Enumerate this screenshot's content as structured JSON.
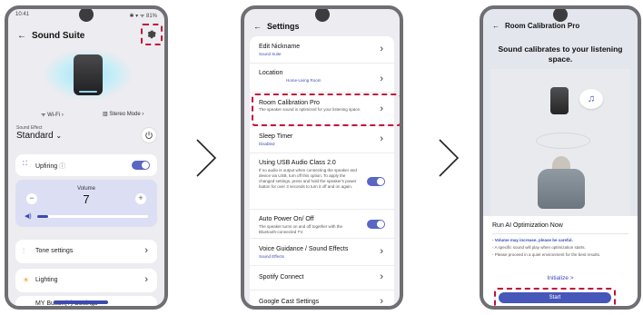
{
  "screen1": {
    "status_time": "10:41",
    "status_right": "✱ ▾ ᯤ 81%",
    "back_arrow": "←",
    "title": "Sound Suite",
    "wifi_label": "Wi-Fi",
    "stereo_label": "Stereo Mode",
    "sound_effect_label": "Sound Effect",
    "sound_effect_value": "Standard",
    "upfiring_label": "Upfiring",
    "volume_label": "Volume",
    "volume_value": "7",
    "volume_level": 0.1,
    "volume_minus": "−",
    "volume_plus": "+",
    "tone_label": "Tone settings",
    "lighting_label": "Lighting",
    "mybutton_label": "MY Button(?) Settings",
    "chevron": "›"
  },
  "screen2": {
    "back_arrow": "←",
    "title": "Settings",
    "items": [
      {
        "title": "Edit Nickname",
        "sub": "Sound Suite"
      },
      {
        "title": "Location",
        "sub": "Home-Living Room"
      },
      {
        "title": "Room Calibration Pro",
        "desc": "The speaker sound is optimized for your listening space."
      },
      {
        "title": "Sleep Timer",
        "sub": "Disabled"
      },
      {
        "title": "Using USB Audio Class 2.0",
        "desc": "If no audio is output when connecting the speaker and device via USB, turn off this option. To apply the changed settings, press and hold the speaker's power button for over 3 seconds to turn it off and on again."
      },
      {
        "title": "Auto Power On/ Off",
        "desc": "The speaker turns on and off together with the Bluetooth-connected TV."
      },
      {
        "title": "Voice Guidance / Sound Effects",
        "sub": "Sound Effects"
      },
      {
        "title": "Spotify Connect"
      },
      {
        "title": "Google Cast Settings"
      }
    ]
  },
  "screen3": {
    "back_arrow": "←",
    "title": "Room Calibration Pro",
    "subtitle": "Sound calibrates to your listening space.",
    "panel_title": "Run AI Optimization Now",
    "bullet1": "- Volume may increase, please be careful.",
    "bullet2": "- A specific sound will play when optimization starts.",
    "bullet3": "- Please proceed in a quiet environment for the best results.",
    "initialize_label": "Initialize >",
    "start_label": "Start"
  },
  "colors": {
    "accent": "#4656b9",
    "highlight": "#c2103a",
    "toggle": "#5966c4"
  }
}
